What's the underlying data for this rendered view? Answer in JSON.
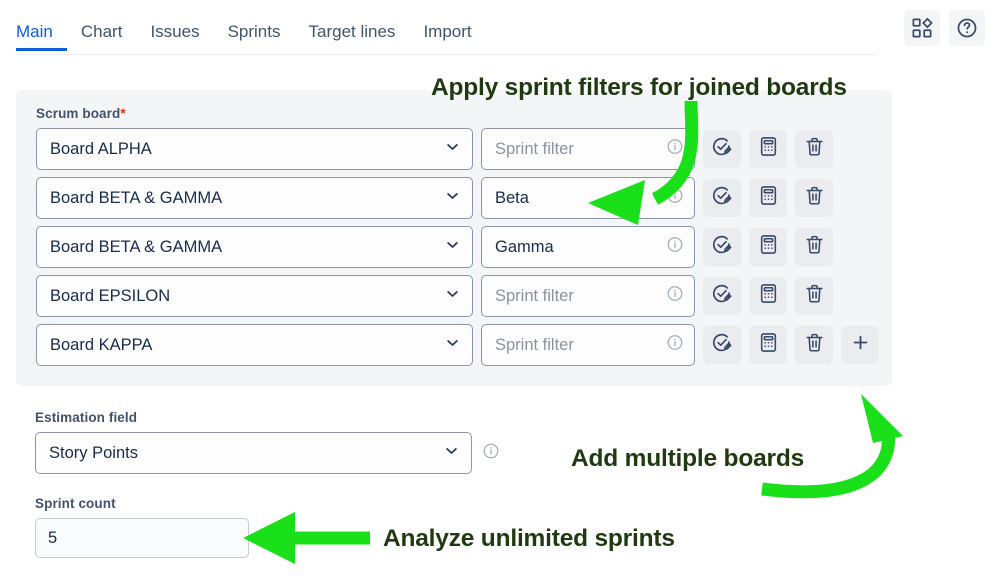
{
  "tabs": [
    {
      "label": "Main",
      "active": true
    },
    {
      "label": "Chart",
      "active": false
    },
    {
      "label": "Issues",
      "active": false
    },
    {
      "label": "Sprints",
      "active": false
    },
    {
      "label": "Target lines",
      "active": false
    },
    {
      "label": "Import",
      "active": false
    }
  ],
  "top_icons": [
    {
      "name": "apps-grid-icon",
      "title": "Apps"
    },
    {
      "name": "help-circle-icon",
      "title": "Help"
    }
  ],
  "panel": {
    "scrum_board_label": "Scrum board",
    "required_marker": "*",
    "sprint_filter_placeholder": "Sprint filter",
    "add_button_label": "+",
    "rows": [
      {
        "board": "Board ALPHA",
        "filter": "",
        "filter_is_placeholder": true,
        "has_add": false
      },
      {
        "board": "Board BETA & GAMMA",
        "filter": "Beta",
        "filter_is_placeholder": false,
        "has_add": false
      },
      {
        "board": "Board BETA & GAMMA",
        "filter": "Gamma",
        "filter_is_placeholder": false,
        "has_add": false
      },
      {
        "board": "Board EPSILON",
        "filter": "",
        "filter_is_placeholder": true,
        "has_add": false
      },
      {
        "board": "Board KAPPA",
        "filter": "",
        "filter_is_placeholder": true,
        "has_add": true
      }
    ],
    "row_actions": [
      {
        "name": "validate-check-edit-icon"
      },
      {
        "name": "calculator-icon"
      },
      {
        "name": "trash-icon"
      }
    ]
  },
  "estimation": {
    "label": "Estimation field",
    "value": "Story Points"
  },
  "sprint_count": {
    "label": "Sprint count",
    "value": "5"
  },
  "annotations": [
    {
      "id": "anno-filters",
      "text": "Apply sprint filters for joined boards"
    },
    {
      "id": "anno-add",
      "text": "Add multiple boards"
    },
    {
      "id": "anno-sprints",
      "text": "Analyze unlimited sprints"
    }
  ],
  "colors": {
    "accent_blue": "#0B5ED7",
    "panel_gray": "#F4F5F7",
    "text_dark": "#172B4D",
    "arrow_green": "#19E019",
    "annotation_green": "#1F3A10",
    "required_red": "#DE350B"
  }
}
